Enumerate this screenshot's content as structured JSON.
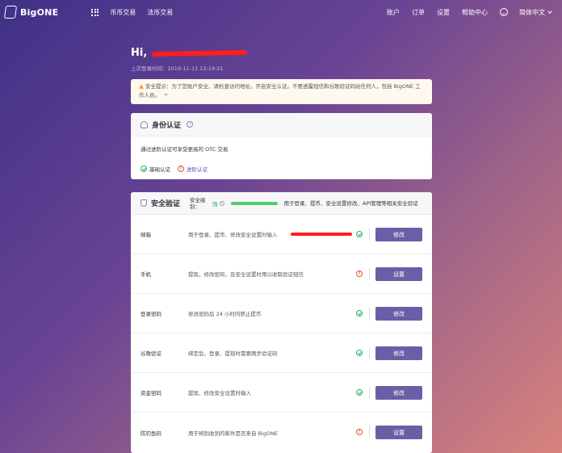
{
  "nav": {
    "brand": "BigONE",
    "links": [
      "币币交易",
      "法币交易"
    ],
    "right_links": [
      "账户",
      "订单",
      "设置",
      "帮助中心"
    ],
    "language": "简体中文"
  },
  "greeting": {
    "hi": "Hi,",
    "last_login": "上次登录时间：2019-11-11 12:19:21"
  },
  "notice": {
    "text": "安全提示：为了您账户安全，请检查访问地址，开启安全认证。不要透露短信和谷歌验证码给任何人，包括 BigONE 工作人员。"
  },
  "identity": {
    "title": "身份认证",
    "description": "通过进阶认证可享受更高的 OTC 交易",
    "basic_label": "基础认证",
    "advanced_label": "进阶认证"
  },
  "security": {
    "title": "安全验证",
    "level_label": "安全级别：",
    "level_value": "强",
    "level_fraction": 1.0,
    "level_desc": "用于登录、提币、安全设置修改、API管理等相关安全验证",
    "rows": [
      {
        "label": "邮箱",
        "desc": "用于登录、提币、修改安全设置时输入",
        "status": "ok",
        "button": "修改",
        "redacted": true
      },
      {
        "label": "手机",
        "desc": "提现，修改密码，及安全设置时用以收取验证短信",
        "status": "warn",
        "button": "设置",
        "redacted": false
      },
      {
        "label": "登录密码",
        "desc": "修改密码后 24 小时内禁止提币",
        "status": "ok",
        "button": "修改",
        "redacted": false
      },
      {
        "label": "谷歌验证",
        "desc": "绑定后，登录、提现时需要两步验证码",
        "status": "ok",
        "button": "修改",
        "redacted": false
      },
      {
        "label": "资金密码",
        "desc": "提现、修改安全设置时输入",
        "status": "ok",
        "button": "修改",
        "redacted": false
      },
      {
        "label": "防钓鱼码",
        "desc": "用于辨别收到的邮件是否来自 BigONE",
        "status": "warn",
        "button": "设置",
        "redacted": false
      }
    ]
  },
  "colors": {
    "accent": "#6a5fa6",
    "ok": "#27b35d",
    "warn": "#e2552d"
  }
}
